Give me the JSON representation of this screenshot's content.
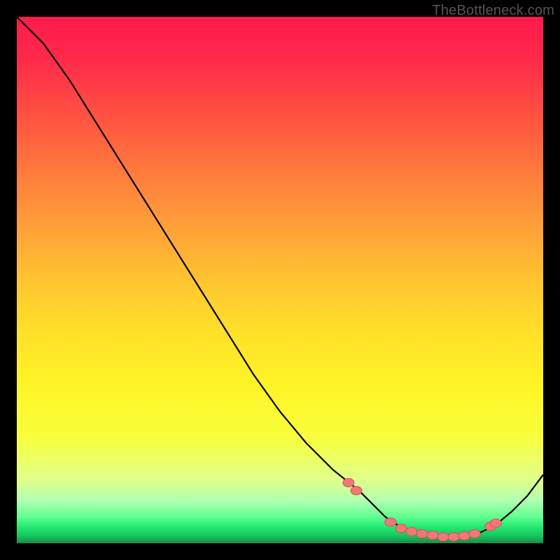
{
  "watermark": "TheBottleneck.com",
  "chart_data": {
    "type": "line",
    "title": "",
    "xlabel": "",
    "ylabel": "",
    "xlim": [
      0,
      100
    ],
    "ylim": [
      0,
      100
    ],
    "series": [
      {
        "name": "bottleneck-curve",
        "x": [
          0,
          5,
          10,
          15,
          20,
          25,
          30,
          35,
          40,
          45,
          50,
          55,
          60,
          65,
          68,
          70,
          73,
          76,
          79,
          82,
          85,
          88,
          91,
          94,
          97,
          100
        ],
        "values": [
          100,
          95,
          88,
          80,
          72,
          64,
          56,
          48,
          40,
          32,
          25,
          19,
          14,
          10,
          7,
          5,
          3,
          2,
          1.5,
          1,
          1.2,
          2,
          3.5,
          6,
          9,
          13
        ]
      }
    ],
    "markers": {
      "name": "optimal-zone",
      "x": [
        63,
        64.5,
        71,
        73,
        75,
        77,
        79,
        81,
        83,
        85,
        87,
        90,
        91
      ],
      "values": [
        11.5,
        10,
        4,
        2.8,
        2.2,
        1.8,
        1.5,
        1.2,
        1.2,
        1.4,
        1.8,
        3.2,
        3.8
      ]
    },
    "colors": {
      "curve": "#000000",
      "marker_fill": "#f07878",
      "marker_stroke": "#d85050"
    }
  }
}
